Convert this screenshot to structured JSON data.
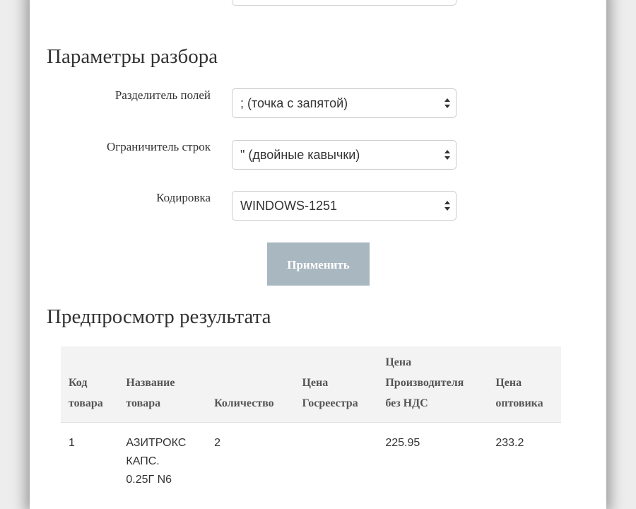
{
  "parse_params": {
    "title": "Параметры разбора",
    "fields": [
      {
        "label": "Разделитель полей",
        "value": "; (точка с запятой)"
      },
      {
        "label": "Ограничитель строк",
        "value": "\" (двойные кавычки)"
      },
      {
        "label": "Кодировка",
        "value": "WINDOWS-1251"
      }
    ],
    "apply_label": "Применить"
  },
  "preview": {
    "title": "Предпросмотр результата",
    "columns": [
      [
        "Код",
        "товара"
      ],
      [
        "Название",
        "товара"
      ],
      [
        "Количество"
      ],
      [
        "Цена",
        "Госреестра"
      ],
      [
        "Цена",
        "Производителя",
        "без НДС"
      ],
      [
        "Цена",
        "оптовика"
      ]
    ],
    "rows": [
      [
        [
          "1"
        ],
        [
          "АЗИТРОКС",
          "КАПС.",
          "0.25Г N6"
        ],
        [
          "2"
        ],
        [
          ""
        ],
        [
          "225.95"
        ],
        [
          "233.2"
        ]
      ]
    ]
  },
  "icons": {
    "select_arrow": "up-down-arrows-icon"
  },
  "colors": {
    "apply_button_bg": "#a9b7c1",
    "table_header_bg": "#f3f3f3"
  }
}
